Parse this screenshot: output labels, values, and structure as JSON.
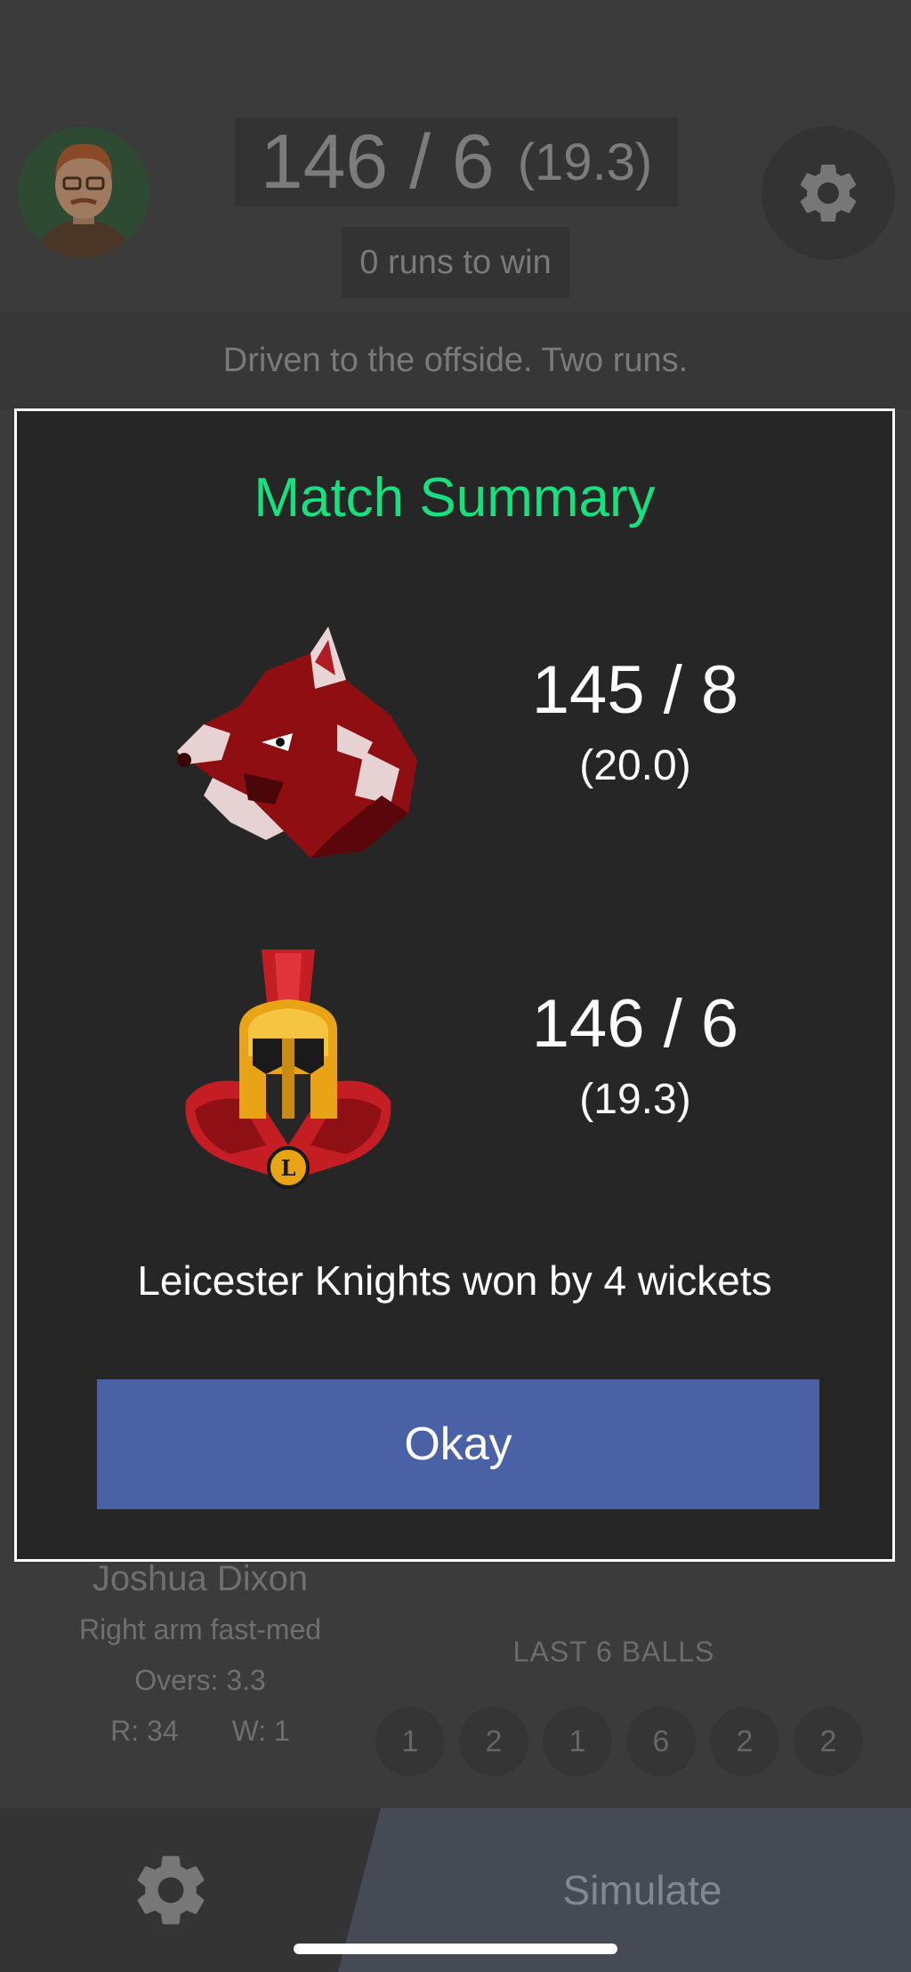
{
  "header": {
    "score": "146 / 6",
    "overs": "(19.3)",
    "target_text": "0 runs to win"
  },
  "commentary": "Driven to the offside. Two runs.",
  "bowler": {
    "name": "Joshua Dixon",
    "style": "Right arm fast-med",
    "overs_label": "Overs:",
    "overs_value": "3.3",
    "runs_label": "R:",
    "runs_value": "34",
    "wickets_label": "W:",
    "wickets_value": "1"
  },
  "last_balls": {
    "label": "LAST 6 BALLS",
    "values": [
      "1",
      "2",
      "1",
      "6",
      "2",
      "2"
    ]
  },
  "bottom_bar": {
    "simulate_label": "Simulate"
  },
  "modal": {
    "title": "Match Summary",
    "team1": {
      "logo": "wolf-logo",
      "score": "145 / 8",
      "overs": "(20.0)"
    },
    "team2": {
      "logo": "spartan-helmet-logo",
      "score": "146 / 6",
      "overs": "(19.3)"
    },
    "result": "Leicester Knights won by 4 wickets",
    "okay_label": "Okay"
  },
  "colors": {
    "title_green": "#19e07f",
    "button_blue": "#4a61a6",
    "modal_bg": "#262626"
  }
}
